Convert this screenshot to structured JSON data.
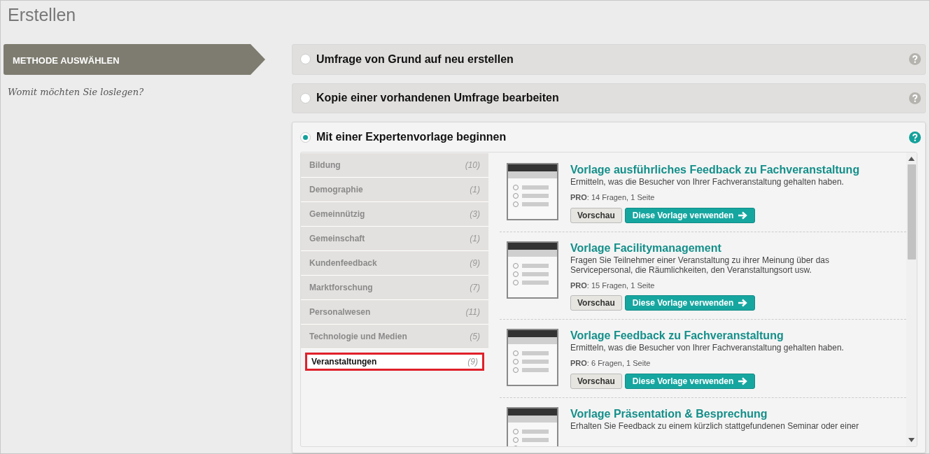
{
  "page_title": "Erstellen",
  "step": {
    "label": "METHODE AUSWÄHLEN",
    "prompt": "Womit möchten Sie loslegen?"
  },
  "options": [
    {
      "label": "Umfrage von Grund auf neu erstellen",
      "selected": false
    },
    {
      "label": "Kopie einer vorhandenen Umfrage bearbeiten",
      "selected": false
    },
    {
      "label": "Mit einer Expertenvorlage beginnen",
      "selected": true
    }
  ],
  "categories": [
    {
      "label": "Bildung",
      "count": "(10)",
      "selected": false
    },
    {
      "label": "Demographie",
      "count": "(1)",
      "selected": false
    },
    {
      "label": "Gemeinnützig",
      "count": "(3)",
      "selected": false
    },
    {
      "label": "Gemeinschaft",
      "count": "(1)",
      "selected": false
    },
    {
      "label": "Kundenfeedback",
      "count": "(9)",
      "selected": false
    },
    {
      "label": "Marktforschung",
      "count": "(7)",
      "selected": false
    },
    {
      "label": "Personalwesen",
      "count": "(11)",
      "selected": false
    },
    {
      "label": "Technologie und Medien",
      "count": "(5)",
      "selected": false
    },
    {
      "label": "Veranstaltungen",
      "count": "(9)",
      "selected": true
    }
  ],
  "templates": [
    {
      "title": "Vorlage ausführliches Feedback zu Fachveranstaltung",
      "description": "Ermitteln, was die Besucher von Ihrer Fachveranstaltung gehalten haben.",
      "meta": "**PRO**: 14 Fragen, 1 Seite",
      "preview": "Vorschau",
      "use": "Diese Vorlage verwenden"
    },
    {
      "title": "Vorlage Facilitymanagement",
      "description": "Fragen Sie Teilnehmer einer Veranstaltung zu ihrer Meinung über das Servicepersonal, die Räumlichkeiten, den Veranstaltungsort usw.",
      "meta": "**PRO**: 15 Fragen, 1 Seite",
      "preview": "Vorschau",
      "use": "Diese Vorlage verwenden"
    },
    {
      "title": "Vorlage Feedback zu Fachveranstaltung",
      "description": "Ermitteln, was die Besucher von Ihrer Fachveranstaltung gehalten haben.",
      "meta": "**PRO**: 6 Fragen, 1 Seite",
      "preview": "Vorschau",
      "use": "Diese Vorlage verwenden"
    },
    {
      "title": "Vorlage Präsentation & Besprechung",
      "description": "Erhalten Sie Feedback zu einem kürzlich stattgefundenen Seminar oder einer"
    }
  ]
}
